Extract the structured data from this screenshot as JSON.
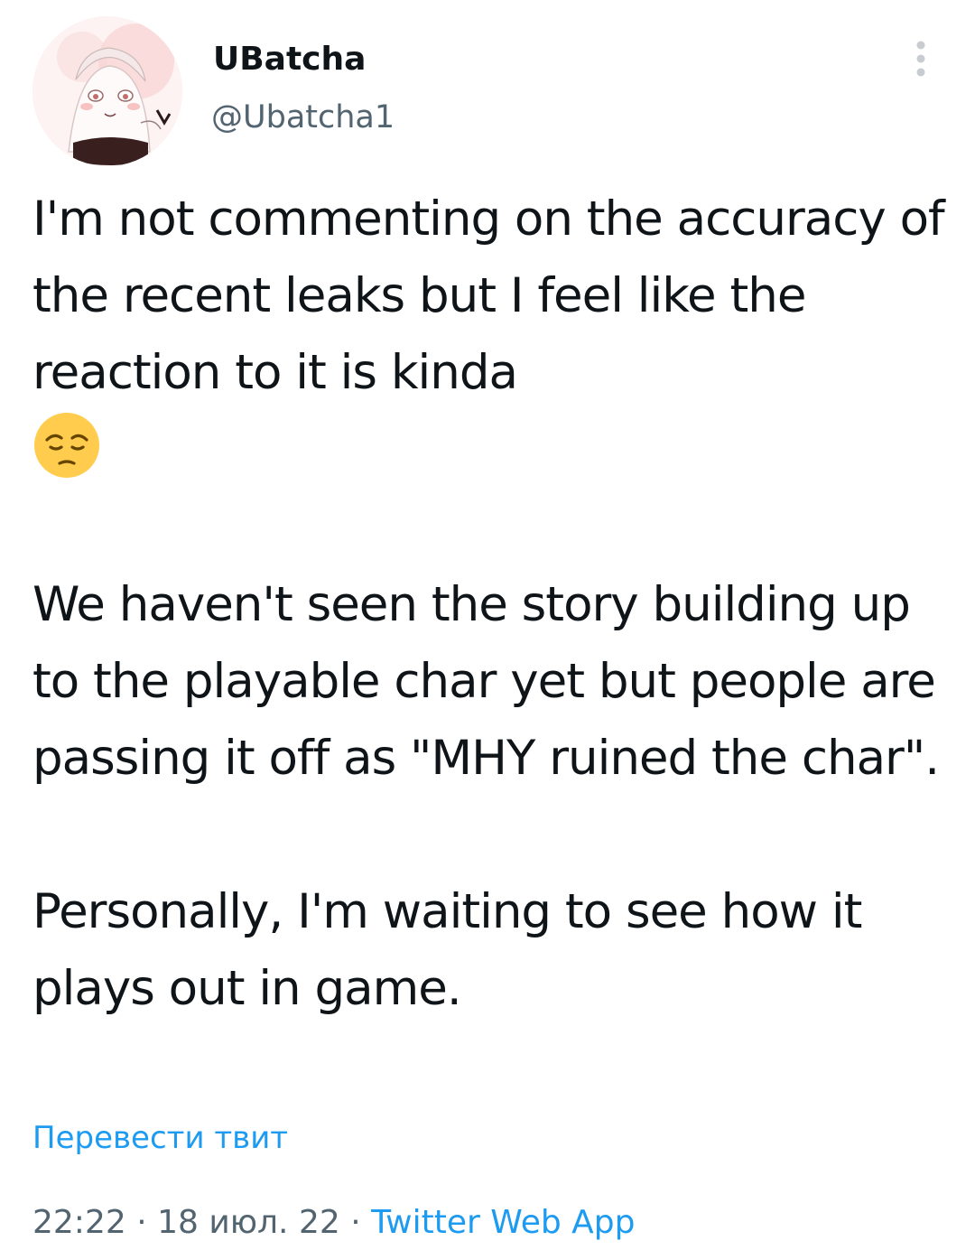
{
  "author": {
    "name": "UBatcha",
    "handle": "@Ubatcha1"
  },
  "tweet": {
    "paragraph_1": "I'm not commenting on the accuracy of the recent leaks but I feel like the reaction to it is kinda",
    "paragraph_1_emoji": "pensive-face-emoji",
    "paragraph_2": "We haven't seen the story building up to the playable char yet but people are passing it off as \"MHY ruined the char\".",
    "paragraph_3": "Personally, I'm waiting to see how it plays out in game."
  },
  "translate_label": "Перевести твит",
  "meta": {
    "time": "22:22",
    "separator": " · ",
    "date": "18 июл. 22",
    "source": "Twitter Web App"
  },
  "icons": {
    "more": "more-vertical-icon"
  },
  "colors": {
    "link": "#1d9bf0",
    "secondary_text": "#536471",
    "primary_text": "#0f1419"
  }
}
